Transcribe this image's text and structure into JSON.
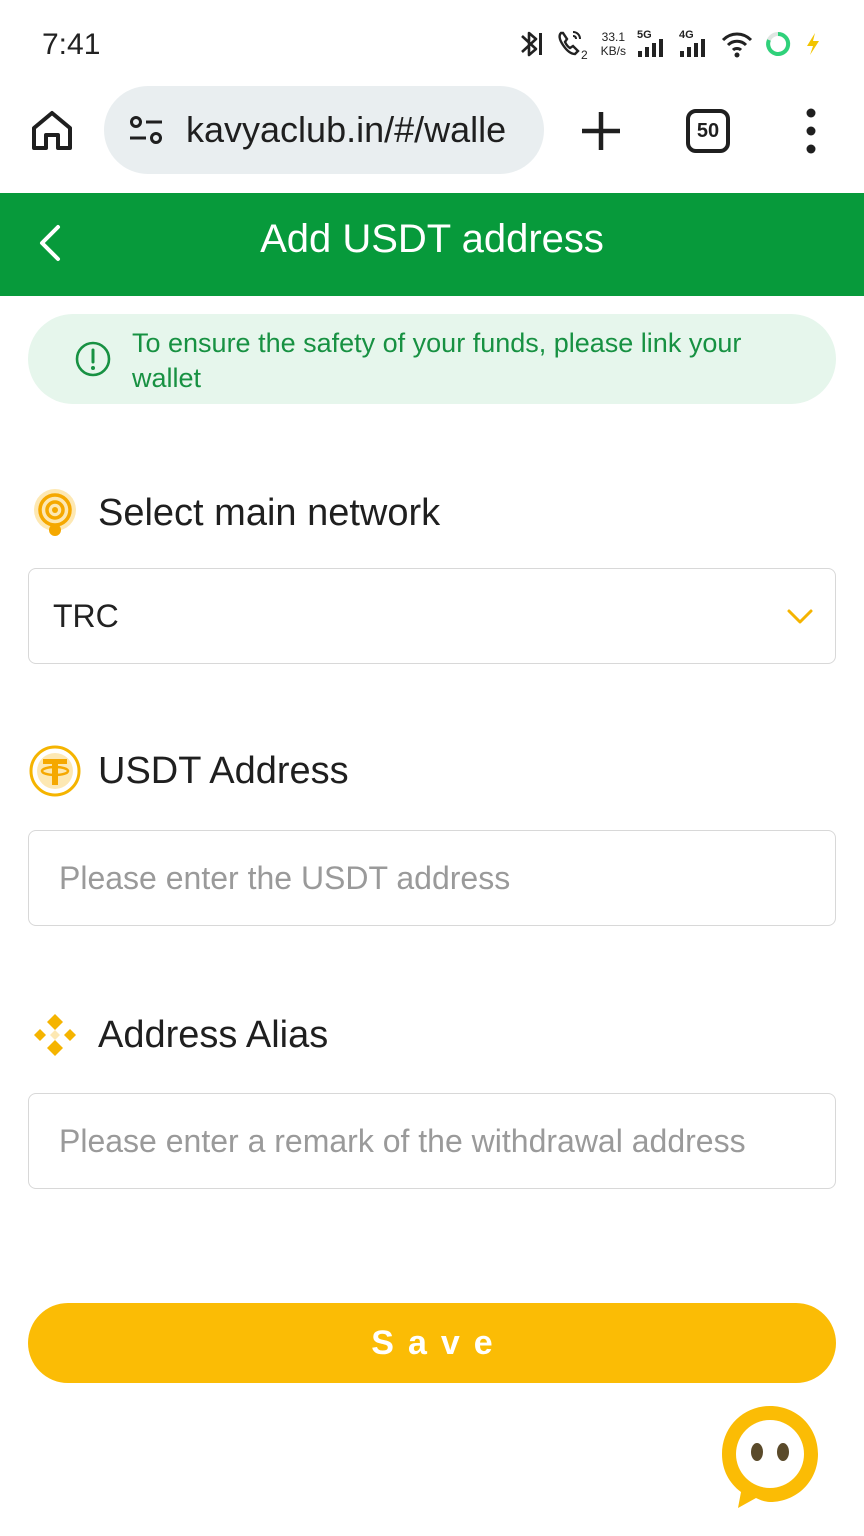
{
  "status_bar": {
    "time": "7:41",
    "net_speed_value": "33.1",
    "net_speed_unit": "KB/s",
    "sim1_label": "5G",
    "sim2_label": "4G",
    "call_sub": "2"
  },
  "browser": {
    "url": "kavyaclub.in/#/walle",
    "tab_count": "50"
  },
  "header": {
    "title": "Add USDT address"
  },
  "notice": {
    "text": "To ensure the safety of your funds, please link your wallet"
  },
  "network": {
    "label": "Select main network",
    "selected": "TRC"
  },
  "address": {
    "label": "USDT Address",
    "value": "",
    "placeholder": "Please enter the USDT address"
  },
  "alias": {
    "label": "Address Alias",
    "value": "",
    "placeholder": "Please enter a remark of the withdrawal address"
  },
  "save": {
    "label": "Save"
  },
  "colors": {
    "header_green": "#079a3b",
    "notice_bg": "#e6f6ec",
    "notice_text": "#179142",
    "accent_yellow": "#fbbc05"
  }
}
